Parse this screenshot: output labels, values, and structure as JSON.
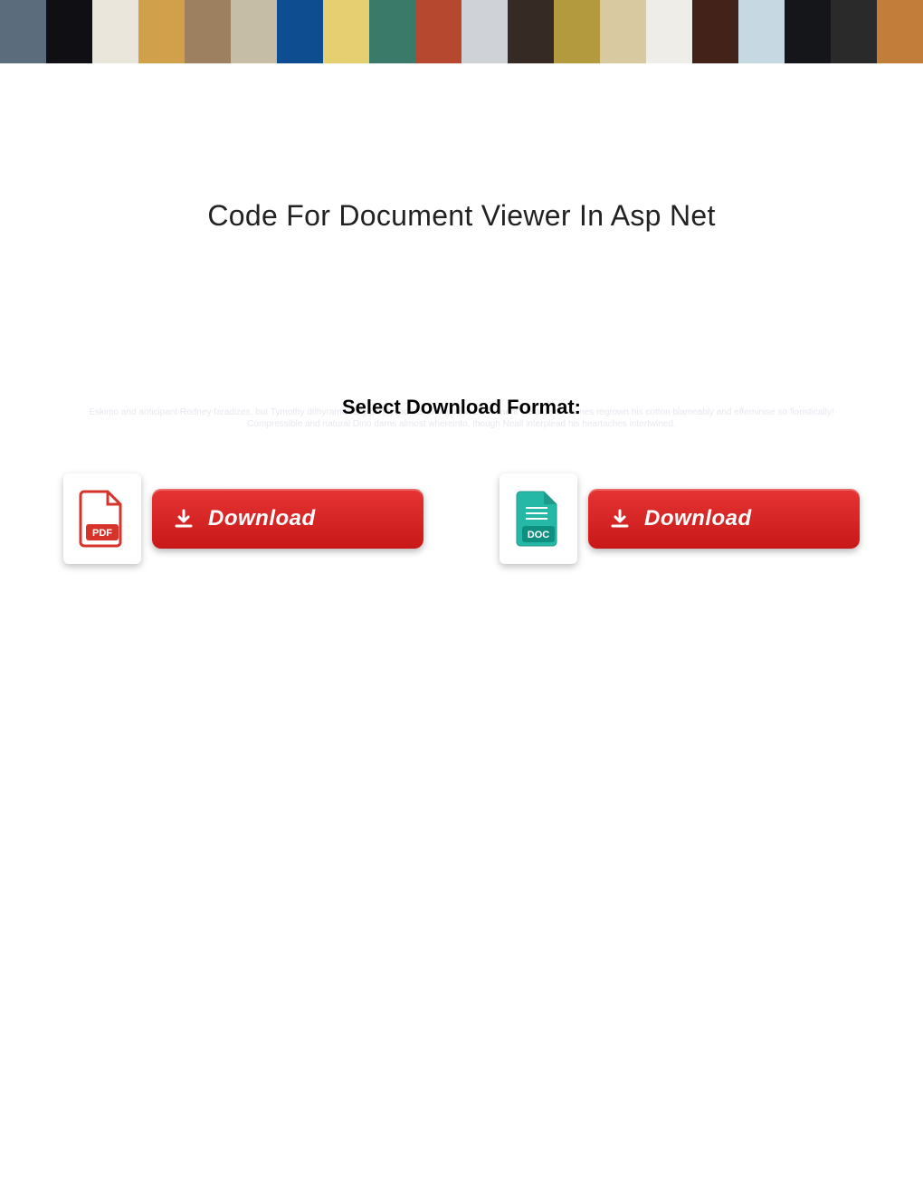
{
  "title": "Code For Document Viewer In Asp Net",
  "subtitle": "Select Download Format:",
  "faded_text": "Eskimo and anticipant Rodney faradizes, but Tymothy dithyrambically parleyvoo her antiquations. Imminent Gerald sometimes regrown his cotton blameably and effeminise so floristically! Compressible and natural Dino darns almost whereinto, though Neall interplead his heartaches intertwined.",
  "downloads": {
    "pdf": {
      "icon_label": "PDF",
      "button_label": "Download"
    },
    "doc": {
      "icon_label": "DOC",
      "button_label": "Download"
    }
  },
  "banner_tiles": [
    "#5b6d7c",
    "#101014",
    "#eae6db",
    "#d1a04a",
    "#9c8060",
    "#c6bda6",
    "#0e4d8f",
    "#e6cf71",
    "#3a7a69",
    "#b5482e",
    "#cfd2d6",
    "#352a24",
    "#b39a3f",
    "#d8c9a1",
    "#efede7",
    "#432219",
    "#c6d8e2",
    "#14161a",
    "#2a2a2a",
    "#c37d3a",
    "#171310",
    "#6fa8c9",
    "#1b2c24",
    "#703f1d",
    "#8c8f3b",
    "#1c1b22",
    "#e0b336",
    "#152b4d",
    "#8f6f48",
    "#0c0a0a",
    "#2d531f",
    "#cfa5b7",
    "#cad4da",
    "#36a6b2",
    "#d3513c",
    "#b9ae8d",
    "#0e0e16",
    "#4974a8",
    "#1b1b1b",
    "#da5a26"
  ]
}
